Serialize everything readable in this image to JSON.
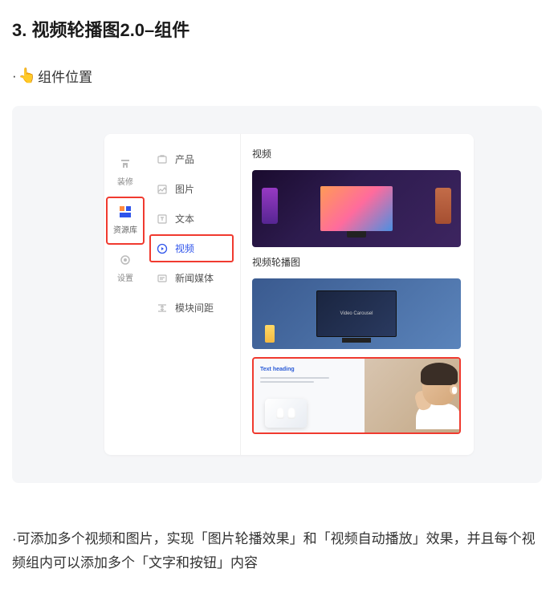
{
  "section": {
    "title": "3. 视频轮播图2.0–组件",
    "intro_prefix": "·",
    "intro_emoji": "👆",
    "intro_text": "组件位置"
  },
  "rail": {
    "items": [
      {
        "label": "装修"
      },
      {
        "label": "资源库"
      },
      {
        "label": "设置"
      }
    ]
  },
  "component_list": {
    "items": [
      {
        "label": "产品"
      },
      {
        "label": "图片"
      },
      {
        "label": "文本"
      },
      {
        "label": "视频"
      },
      {
        "label": "新闻媒体"
      },
      {
        "label": "模块间距"
      }
    ]
  },
  "preview": {
    "heading_video": "视频",
    "heading_carousel": "视频轮播图",
    "carousel_monitor_text": "Video Carousel",
    "product_heading": "Text heading"
  },
  "description": {
    "prefix": "·",
    "text": "可添加多个视频和图片，实现「图片轮播效果」和「视频自动播放」效果，并且每个视频组内可以添加多个「文字和按钮」内容"
  }
}
